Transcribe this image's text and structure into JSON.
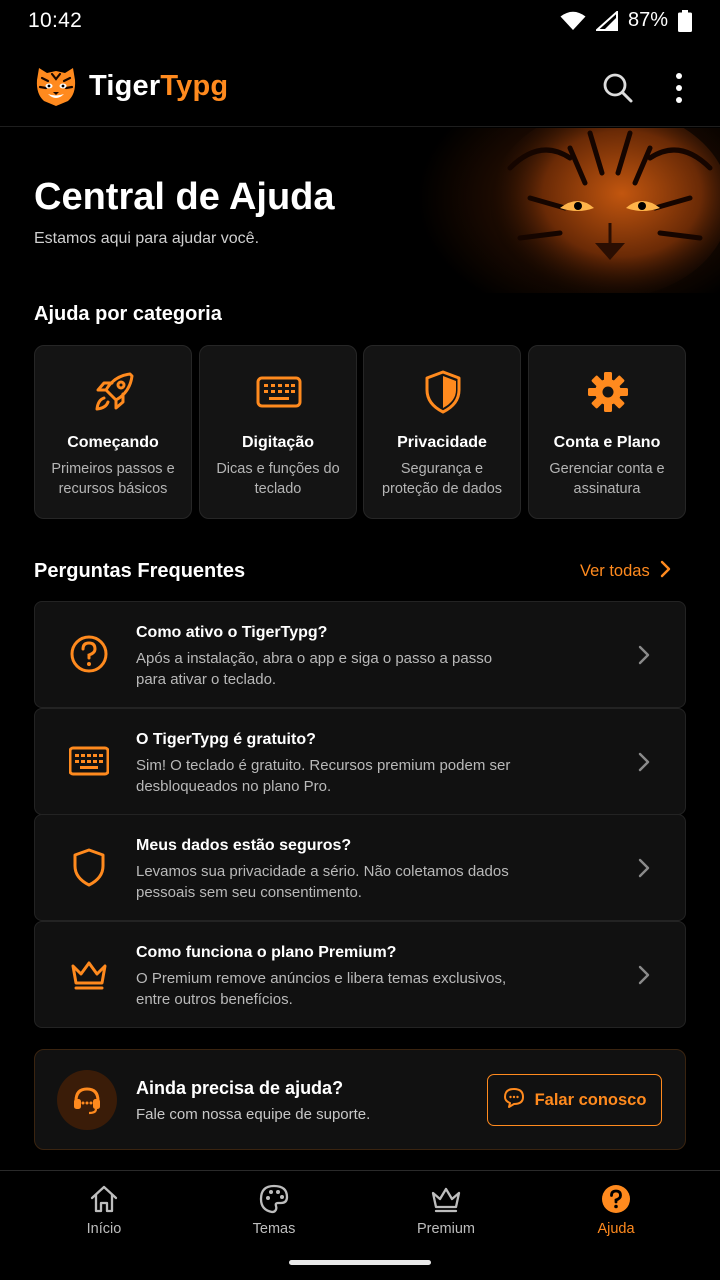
{
  "status": {
    "time": "10:42",
    "battery": "87%"
  },
  "app": {
    "name_part1": "Tiger",
    "name_part2": "Typg"
  },
  "hero": {
    "title": "Central de Ajuda",
    "subtitle": "Estamos aqui para ajudar você."
  },
  "categories": {
    "title": "Ajuda por categoria",
    "items": [
      {
        "title": "Começando",
        "desc": "Primeiros passos e recursos básicos",
        "icon": "rocket-icon"
      },
      {
        "title": "Digitação",
        "desc": "Dicas e funções do teclado",
        "icon": "keyboard-icon"
      },
      {
        "title": "Privacidade",
        "desc": "Segurança e proteção de dados",
        "icon": "shield-icon"
      },
      {
        "title": "Conta e Plano",
        "desc": "Gerenciar conta e assinatura",
        "icon": "gear-icon"
      }
    ]
  },
  "faq": {
    "title": "Perguntas Frequentes",
    "see_all": "Ver todas",
    "items": [
      {
        "q": "Como ativo o TigerTypg?",
        "a": "Após a instalação, abra o app e siga o passo a passo para ativar o teclado.",
        "icon": "question-icon"
      },
      {
        "q": "O TigerTypg é gratuito?",
        "a": "Sim! O teclado é gratuito. Recursos premium podem ser desbloqueados no plano Pro.",
        "icon": "keyboard-icon"
      },
      {
        "q": "Meus dados estão seguros?",
        "a": "Levamos sua privacidade a sério. Não coletamos dados pessoais sem seu consentimento.",
        "icon": "shield-icon"
      },
      {
        "q": "Como funciona o plano Premium?",
        "a": "O Premium remove anúncios e libera temas exclusivos, entre outros benefícios.",
        "icon": "crown-icon"
      }
    ]
  },
  "contact": {
    "title": "Ainda precisa de ajuda?",
    "subtitle": "Fale com nossa equipe de suporte.",
    "button": "Falar conosco"
  },
  "nav": {
    "items": [
      {
        "label": "Início",
        "icon": "home-icon"
      },
      {
        "label": "Temas",
        "icon": "palette-icon"
      },
      {
        "label": "Premium",
        "icon": "crown-icon"
      },
      {
        "label": "Ajuda",
        "icon": "help-icon",
        "active": true
      }
    ]
  },
  "colors": {
    "accent": "#ff8a1e",
    "background": "#000000",
    "card": "#141414"
  }
}
